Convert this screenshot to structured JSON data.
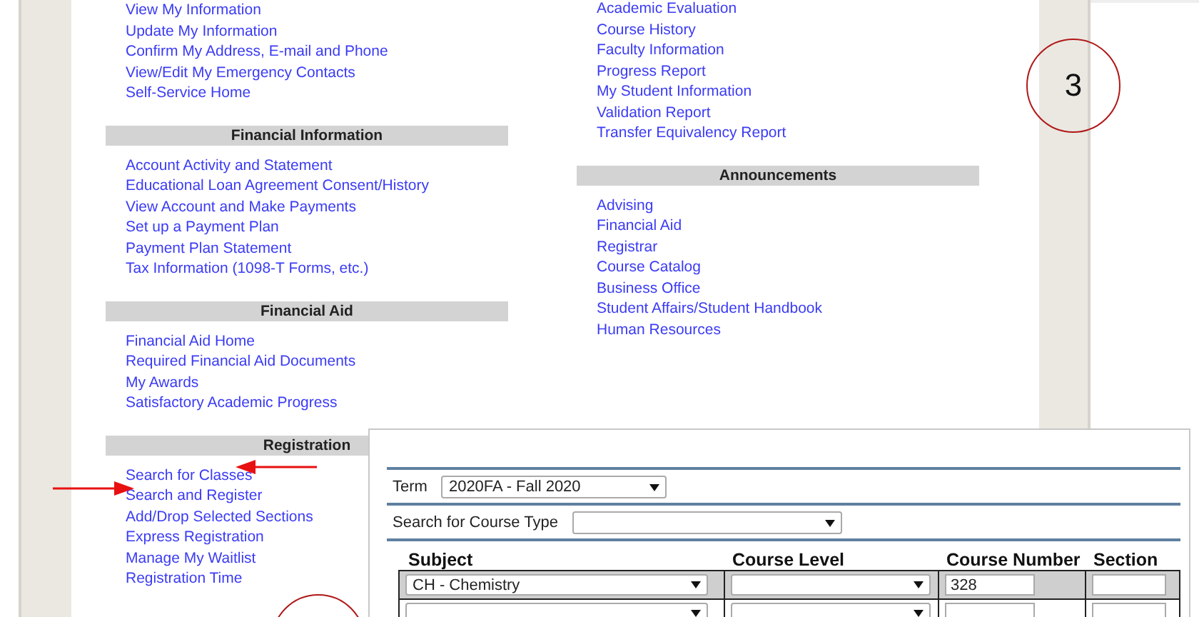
{
  "left_sections": [
    {
      "links": [
        "View My Information",
        "Update My Information",
        "Confirm My Address, E-mail and Phone",
        "View/Edit My Emergency Contacts",
        "Self-Service Home"
      ]
    },
    {
      "title": "Financial Information",
      "links": [
        "Account Activity and Statement",
        "Educational Loan Agreement Consent/History",
        "View Account and Make Payments",
        "Set up a Payment Plan",
        "Payment Plan Statement",
        "Tax Information (1098-T Forms, etc.)"
      ]
    },
    {
      "title": "Financial Aid",
      "links": [
        "Financial Aid Home",
        "Required Financial Aid Documents",
        "My Awards",
        "Satisfactory Academic Progress"
      ]
    },
    {
      "title": "Registration",
      "links": [
        "Search for Classes",
        "Search and Register",
        "Add/Drop Selected Sections",
        "Express Registration",
        "Manage My Waitlist",
        "Registration Time"
      ]
    }
  ],
  "right_sections": [
    {
      "links": [
        "Academic Evaluation",
        "Course History",
        "Faculty Information",
        "Progress Report",
        "My Student Information",
        "Validation Report",
        "Transfer Equivalency Report"
      ]
    },
    {
      "title": "Announcements",
      "links": [
        "Advising",
        "Financial Aid",
        "Registrar",
        "Course Catalog",
        "Business Office",
        "Student Affairs/Student Handbook",
        "Human Resources"
      ]
    }
  ],
  "search_form": {
    "term": {
      "label": "Term",
      "value": "2020FA - Fall 2020"
    },
    "course_type": {
      "label": "Search for Course Type"
    },
    "columns": [
      "Subject",
      "Course Level",
      "Course Number",
      "Section"
    ],
    "rows": [
      {
        "subject": "CH - Chemistry",
        "course_number": "328",
        "selected": true
      },
      {
        "selected": false
      }
    ]
  },
  "annotations": [
    {
      "kind": "circle",
      "label": "3"
    },
    {
      "kind": "circle"
    },
    {
      "kind": "arrow_left"
    },
    {
      "kind": "arrow_right"
    }
  ]
}
